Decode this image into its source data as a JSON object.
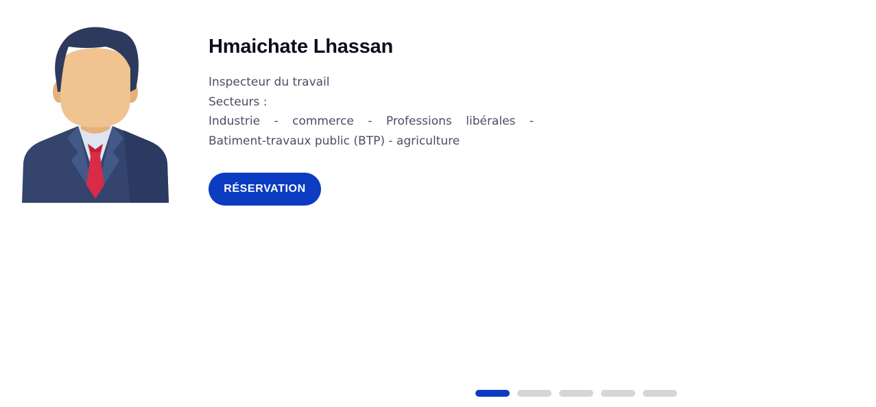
{
  "profile": {
    "name": "Hmaichate Lhassan",
    "role": "Inspecteur du travail",
    "sectors_label": "Secteurs :",
    "sectors_line1": [
      "Industrie",
      "-",
      "commerce",
      "-",
      "Professions",
      "libérales",
      "-"
    ],
    "sectors_line2": "Batiment-travaux public (BTP) - agriculture",
    "avatar_icon": "businessman-avatar-icon"
  },
  "actions": {
    "reserve_label": "RÉSERVATION"
  },
  "carousel": {
    "slide_count": 5,
    "active_index": 0
  },
  "colors": {
    "accent": "#0b3cc1",
    "title": "#0c0c1e",
    "text": "#4b4c63",
    "dot_inactive": "#d6d6d6",
    "suit": "#34446c",
    "skin": "#f0c390",
    "hair": "#2d3a5e",
    "tie": "#d92b47"
  }
}
